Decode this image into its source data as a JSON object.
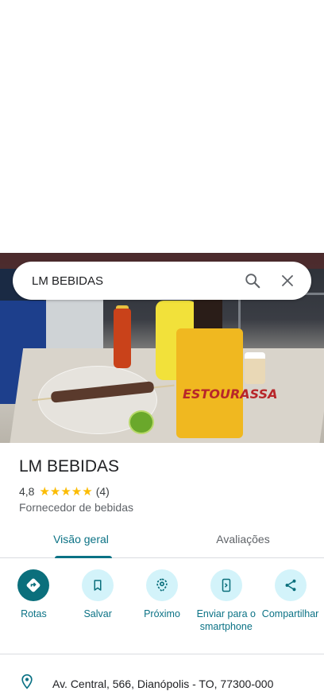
{
  "search": {
    "query": "LM BEBIDAS"
  },
  "place": {
    "name": "LM BEBIDAS",
    "rating": "4,8",
    "stars": "★★★★★",
    "review_count": "(4)",
    "category": "Fornecedor de bebidas",
    "address": "Av. Central, 566, Dianópolis - TO, 77300-000"
  },
  "photo": {
    "cooler_text": "ESTOURASSA"
  },
  "tabs": [
    {
      "label": "Visão geral",
      "active": true
    },
    {
      "label": "Avaliações",
      "active": false
    }
  ],
  "actions": [
    {
      "label": "Rotas",
      "icon": "directions-icon"
    },
    {
      "label": "Salvar",
      "icon": "bookmark-icon"
    },
    {
      "label": "Próximo",
      "icon": "nearby-icon"
    },
    {
      "label": "Enviar para o smartphone",
      "icon": "send-to-phone-icon"
    },
    {
      "label": "Compartilhar",
      "icon": "share-icon"
    }
  ],
  "colors": {
    "accent": "#0b7285",
    "accent_dark": "#0b6f7c",
    "action_bg": "#d3f3fa",
    "star": "#fbbc04"
  }
}
